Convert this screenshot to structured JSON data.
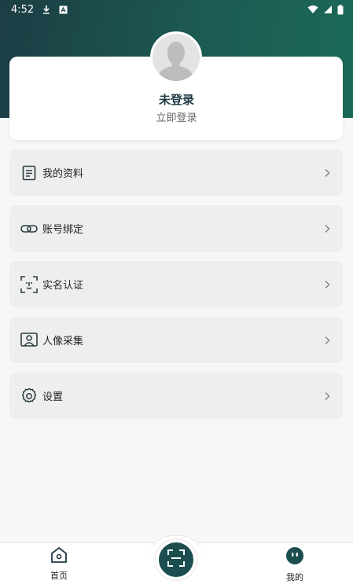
{
  "status_bar": {
    "time": "4:52",
    "icons": [
      "download-icon",
      "notification-a-icon",
      "wifi-icon",
      "cellular-icon",
      "battery-icon"
    ]
  },
  "profile": {
    "name": "未登录",
    "login_link": "立即登录",
    "avatar_icon": "default-avatar-icon"
  },
  "menu": [
    {
      "label": "我的资料",
      "icon": "document-icon"
    },
    {
      "label": "账号绑定",
      "icon": "link-icon"
    },
    {
      "label": "实名认证",
      "icon": "face-scan-icon"
    },
    {
      "label": "人像采集",
      "icon": "portrait-icon"
    },
    {
      "label": "设置",
      "icon": "gear-icon"
    }
  ],
  "bottom_nav": {
    "home_label": "首页",
    "scan_icon": "scan-icon",
    "mine_label": "我的"
  },
  "colors": {
    "header_gradient_start": "#1c3d44",
    "header_gradient_end": "#1b6a58",
    "accent": "#1c4e50",
    "card_bg": "#ffffff",
    "menu_bg": "#eeeeee"
  }
}
